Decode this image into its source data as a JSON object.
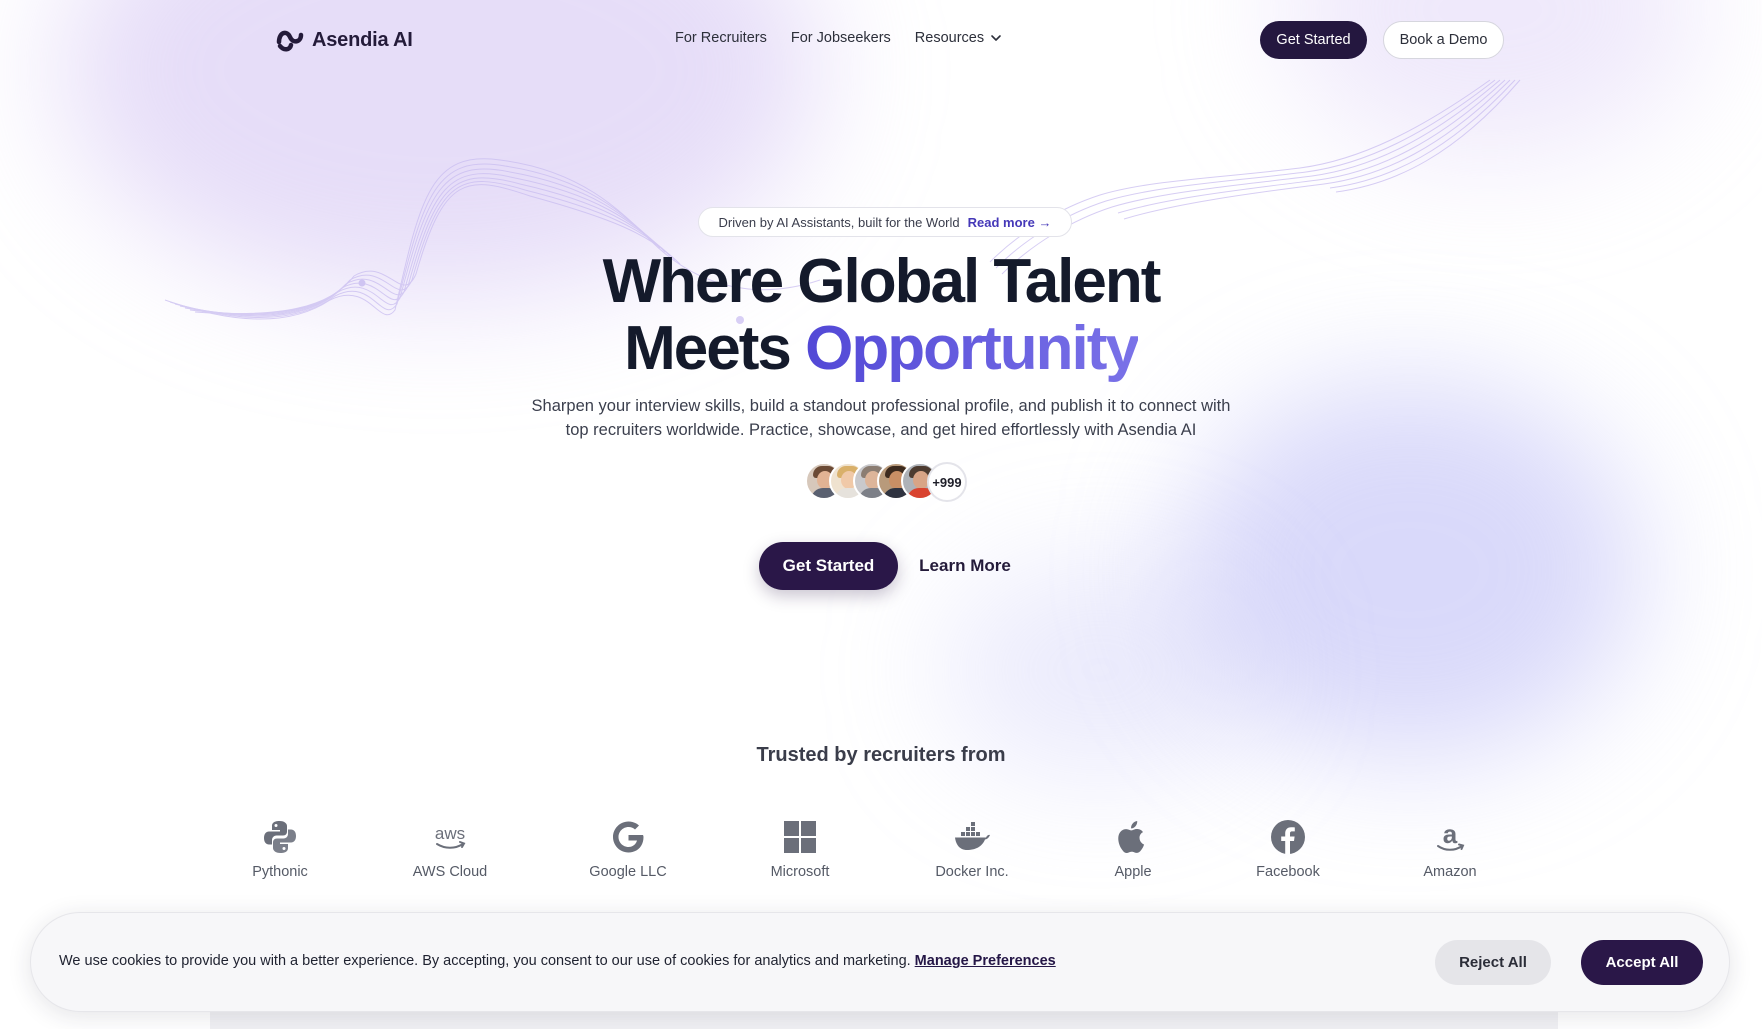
{
  "brand": {
    "name": "Asendia AI",
    "logo_icon": "wave-logo-icon"
  },
  "nav": {
    "items": [
      {
        "label": "For Recruiters"
      },
      {
        "label": "For Jobseekers"
      },
      {
        "label": "Resources",
        "icon": "chevron-down-icon"
      }
    ],
    "get_started": "Get Started",
    "book_demo": "Book a Demo"
  },
  "hero": {
    "pill_text": "Driven by AI Assistants, built for the World",
    "pill_link": "Read more →",
    "title_line1": "Where Global Talent",
    "title_line2_plain": "Meets",
    "title_line2_accent": "Opportunity",
    "subtitle": "Sharpen your interview skills, build a standout professional profile, and publish it to connect with top recruiters worldwide. Practice, showcase, and get hired effortlessly with Asendia AI",
    "avatar_count": "+999",
    "cta_primary": "Get Started",
    "cta_secondary": "Learn More"
  },
  "trusted": {
    "heading": "Trusted by recruiters from",
    "logos": [
      {
        "name": "Pythonic",
        "icon": "python-icon"
      },
      {
        "name": "AWS Cloud",
        "icon": "aws-icon"
      },
      {
        "name": "Google LLC",
        "icon": "google-icon"
      },
      {
        "name": "Microsoft",
        "icon": "microsoft-icon"
      },
      {
        "name": "Docker Inc.",
        "icon": "docker-icon"
      },
      {
        "name": "Apple",
        "icon": "apple-icon"
      },
      {
        "name": "Facebook",
        "icon": "facebook-icon"
      },
      {
        "name": "Amazon",
        "icon": "amazon-icon"
      }
    ]
  },
  "cookie": {
    "text": "We use cookies to provide you with a better experience. By accepting, you consent to our use of cookies for analytics and marketing.",
    "manage_link": "Manage Preferences",
    "reject": "Reject All",
    "accept": "Accept All"
  },
  "colors": {
    "brand_dark": "#2a1748",
    "accent": "#5248d6",
    "text": "#1f2433"
  }
}
